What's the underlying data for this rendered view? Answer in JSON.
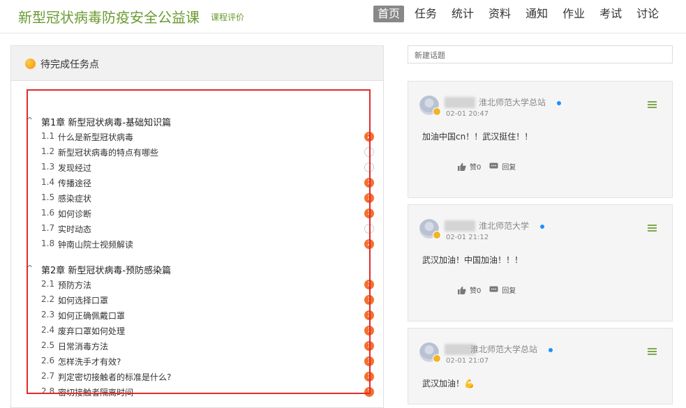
{
  "header": {
    "course_title": "新型冠状病毒防疫安全公益课",
    "course_eval": "课程评价",
    "nav": [
      "首页",
      "任务",
      "统计",
      "资料",
      "通知",
      "作业",
      "考试",
      "讨论"
    ]
  },
  "tasks": {
    "panel_title": "待完成任务点",
    "chapters": [
      {
        "title": "第1章 新型冠状病毒-基础知识篇",
        "sections": [
          {
            "num": "1.1",
            "title": "什么是新型冠状病毒",
            "badge": "2"
          },
          {
            "num": "1.2",
            "title": "新型冠状病毒的特点有哪些",
            "badge": ""
          },
          {
            "num": "1.3",
            "title": "发现经过",
            "badge": ""
          },
          {
            "num": "1.4",
            "title": "传播途径",
            "badge": "1"
          },
          {
            "num": "1.5",
            "title": "感染症状",
            "badge": "1"
          },
          {
            "num": "1.6",
            "title": "如何诊断",
            "badge": "1"
          },
          {
            "num": "1.7",
            "title": "实时动态",
            "badge": ""
          },
          {
            "num": "1.8",
            "title": "钟南山院士视频解读",
            "badge": "2"
          }
        ]
      },
      {
        "title": "第2章 新型冠状病毒-预防感染篇",
        "sections": [
          {
            "num": "2.1",
            "title": "预防方法",
            "badge": "1"
          },
          {
            "num": "2.2",
            "title": "如何选择口罩",
            "badge": "1"
          },
          {
            "num": "2.3",
            "title": "如何正确佩戴口罩",
            "badge": "1"
          },
          {
            "num": "2.4",
            "title": "废弃口罩如何处理",
            "badge": "1"
          },
          {
            "num": "2.5",
            "title": "日常消毒方法",
            "badge": "1"
          },
          {
            "num": "2.6",
            "title": "怎样洗手才有效?",
            "badge": "1"
          },
          {
            "num": "2.7",
            "title": "判定密切接触者的标准是什么?",
            "badge": "1"
          },
          {
            "num": "2.8",
            "title": "密切接触者隔离时间",
            "badge": "1"
          }
        ]
      }
    ]
  },
  "discussion": {
    "new_topic_placeholder": "新建话题",
    "posts": [
      {
        "school": "淮北师范大学总站",
        "time": "02-01 20:47",
        "content": "加油中国cn！！武汉挺住！！",
        "like_label": "赞0",
        "reply_label": "回复"
      },
      {
        "school": "淮北师范大学",
        "time": "02-01 21:12",
        "content": "武汉加油！中国加油！！！",
        "like_label": "赞0",
        "reply_label": "回复"
      },
      {
        "school": "淮北师范大学总站",
        "time": "02-01 21:07",
        "content": "武汉加油！",
        "emoji": "💪"
      }
    ]
  },
  "colors": {
    "brand_green": "#6a9b31",
    "badge_orange": "#f3702f",
    "highlight_red": "#e02a2a",
    "online_blue": "#1e90ff"
  }
}
